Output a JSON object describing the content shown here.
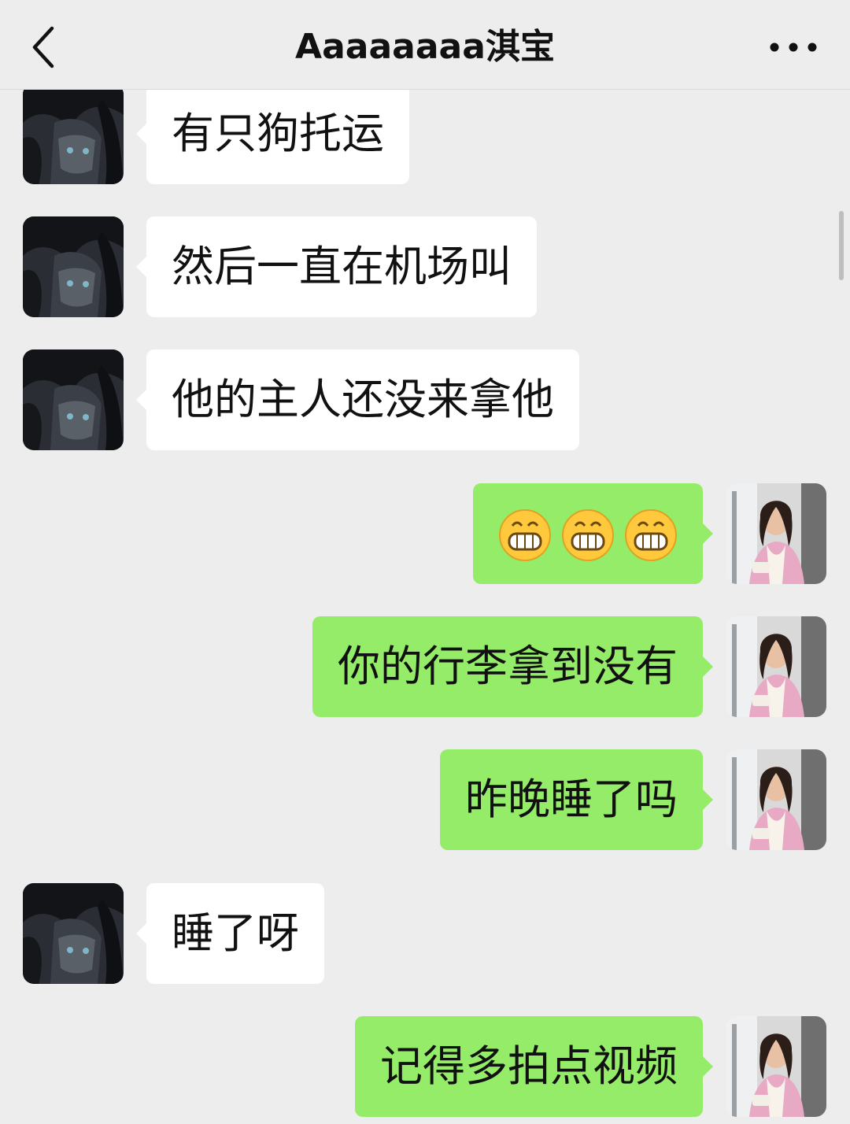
{
  "header": {
    "title": "Aaaaaaaa淇宝",
    "back_icon": "chevron-left-icon",
    "more_icon": "more-dots-icon"
  },
  "colors": {
    "background": "#EDEDED",
    "incoming_bubble": "#FFFFFF",
    "outgoing_bubble": "#95EC69",
    "text": "#111111"
  },
  "messages": [
    {
      "sender": "contact",
      "text": "有只狗托运"
    },
    {
      "sender": "contact",
      "text": "然后一直在机场叫"
    },
    {
      "sender": "contact",
      "text": "他的主人还没来拿他"
    },
    {
      "sender": "me",
      "type": "emoji",
      "emoji": "grinning-face",
      "count": 3
    },
    {
      "sender": "me",
      "text": "你的行李拿到没有"
    },
    {
      "sender": "me",
      "text": "昨晚睡了吗"
    },
    {
      "sender": "contact",
      "text": "睡了呀"
    },
    {
      "sender": "me",
      "text": "记得多拍点视频"
    }
  ]
}
